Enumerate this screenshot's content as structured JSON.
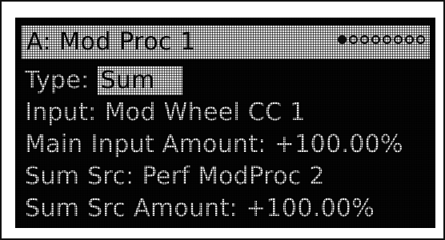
{
  "title": "A: Mod Proc 1",
  "page_indicator": {
    "total": 8,
    "current": 1
  },
  "params": [
    {
      "label": "Type:",
      "value": "Sum",
      "selected": true
    },
    {
      "label": "Input:",
      "value": "Mod Wheel CC 1"
    },
    {
      "label": "Main Input Amount:",
      "value": "+100.00%"
    },
    {
      "label": "Sum Src:",
      "value": "Perf ModProc 2"
    },
    {
      "label": "Sum Src Amount:",
      "value": "+100.00%"
    }
  ],
  "colors": {
    "screen_bg": "#050505",
    "text": "#e9e9e9",
    "highlight": "#e4e4e4"
  }
}
